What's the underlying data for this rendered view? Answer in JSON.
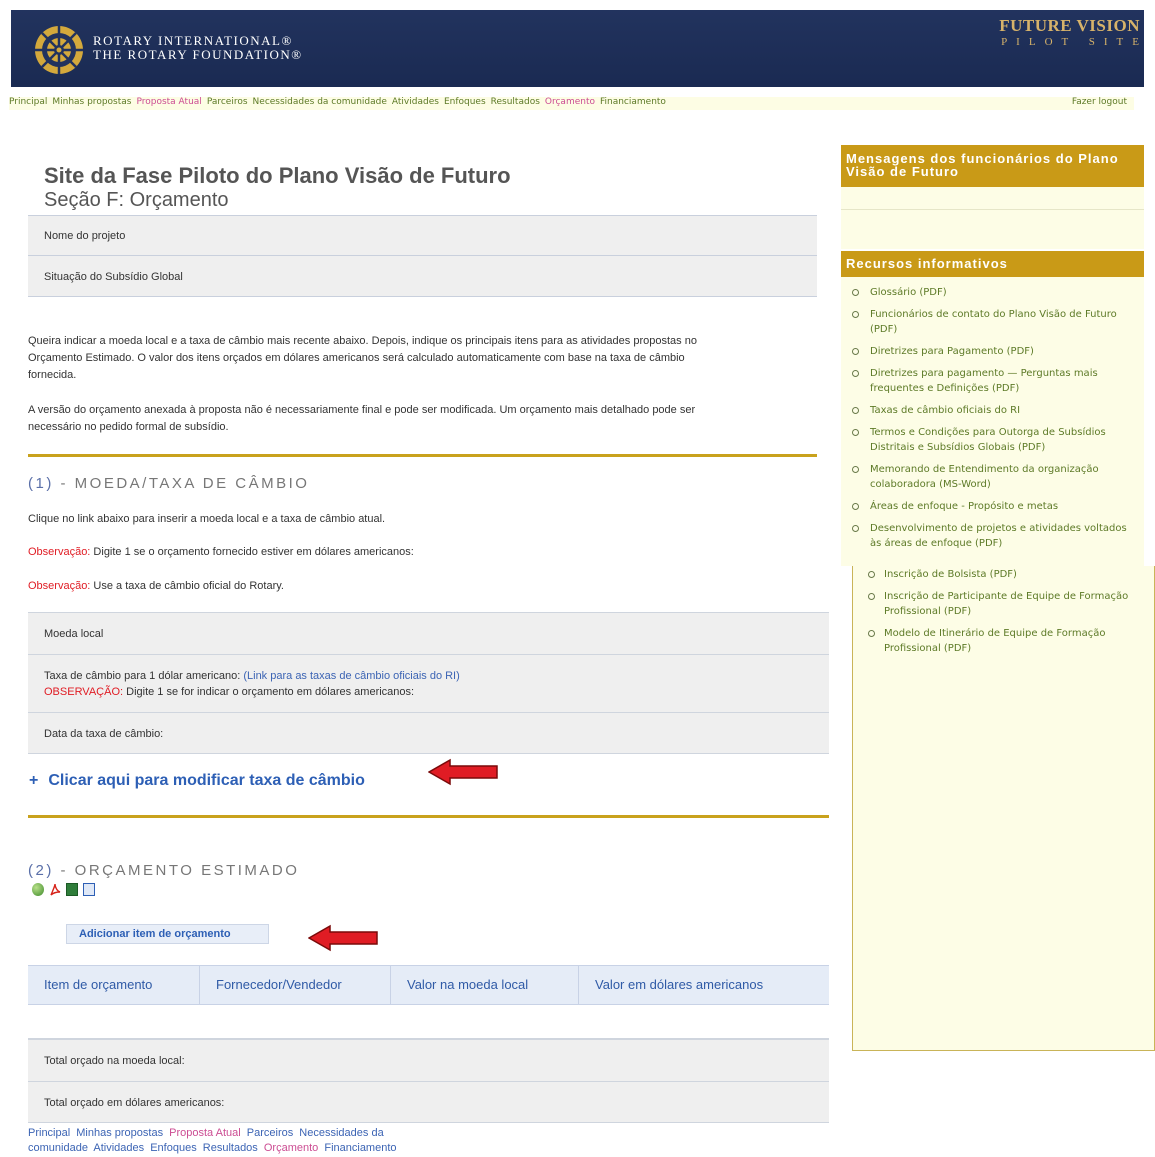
{
  "header": {
    "org_line1": "ROTARY INTERNATIONAL®",
    "org_line2": "THE ROTARY FOUNDATION®",
    "brand_line1": "FUTURE VISION",
    "brand_line2": "PILOT SITE"
  },
  "top_nav": {
    "items": [
      "Principal",
      "Minhas propostas",
      "Proposta Atual",
      "Parceiros",
      "Necessidades da comunidade",
      "Atividades",
      "Enfoques",
      "Resultados",
      "Orçamento",
      "Financiamento"
    ],
    "logout": "Fazer logout"
  },
  "page": {
    "title": "Site da Fase Piloto do Plano Visão de Futuro",
    "subtitle": "Seção F: Orçamento",
    "project_name_label": "Nome do projeto",
    "grant_status_label": "Situação do Subsídio Global",
    "intro_p1": "Queira indicar a moeda local e a taxa de câmbio mais recente abaixo. Depois, indique os principais itens para as atividades propostas no Orçamento Estimado. O valor dos itens orçados em dólares americanos será calculado automaticamente com base na taxa de câmbio fornecida.",
    "intro_p2": "A versão do orçamento anexada à proposta não é necessariamente final e pode ser modificada. Um orçamento mais detalhado pode ser necessário no pedido formal de subsídio."
  },
  "section1": {
    "num": "(1)",
    "title": "- MOEDA/TAXA DE CÂMBIO",
    "instruction": "Clique no link abaixo para inserir a moeda local e a taxa de câmbio atual.",
    "note_label": "Observação:",
    "note1": " Digite 1 se o orçamento fornecido estiver em dólares americanos:",
    "note2": " Use a taxa de câmbio oficial do Rotary.",
    "local_currency_label": "Moeda local",
    "rate_label": "Taxa de câmbio para 1 dólar americano: ",
    "rate_link": "(Link para as taxas de câmbio oficiais do RI)",
    "rate_note_label": "OBSERVAÇÃO:",
    "rate_note": " Digite 1 se for indicar o orçamento em dólares americanos:",
    "rate_date_label": "Data da taxa de câmbio:",
    "modify_plus": "+",
    "modify_link": "Clicar aqui para modificar taxa de câmbio"
  },
  "section2": {
    "num": "(2)",
    "title": "- ORÇAMENTO ESTIMADO",
    "export_icons": [
      "globe-icon",
      "pdf-icon",
      "excel-icon",
      "word-icon"
    ],
    "add_button": "Adicionar item de orçamento",
    "columns": [
      "Item de orçamento",
      "Fornecedor/Vendedor",
      "Valor na moeda local",
      "Valor em dólares americanos"
    ],
    "total_local_label": "Total orçado na moeda local:",
    "total_usd_label": "Total orçado em dólares americanos:"
  },
  "footer_nav": {
    "items": [
      "Principal",
      "Minhas propostas",
      "Proposta Atual",
      "Parceiros",
      "Necessidades da comunidade",
      "Atividades",
      "Enfoques",
      "Resultados",
      "Orçamento",
      "Financiamento"
    ]
  },
  "sidebar": {
    "messages_title": "Mensagens dos funcionários do Plano Visão de Futuro",
    "resources_title": "Recursos informativos",
    "resources": [
      "Glossário (PDF)",
      "Funcionários de contato do Plano Visão de Futuro (PDF)",
      "Diretrizes para Pagamento (PDF)",
      "Diretrizes para pagamento — Perguntas mais frequentes e Definições (PDF)",
      "Taxas de câmbio oficiais do RI",
      "Termos e Condições para Outorga de Subsídios Distritais e Subsídios Globais (PDF)",
      "Memorando de Entendimento da organização colaboradora (MS-Word)",
      "Áreas de enfoque - Propósito e metas",
      "Desenvolvimento de projetos e atividades voltados às áreas de enfoque (PDF)"
    ],
    "resources_extra": [
      "Inscrição de Bolsista (PDF)",
      "Inscrição de Participante de Equipe de Formação Profissional (PDF)",
      "Modelo de Itinerário de Equipe de Formação Profissional (PDF)"
    ]
  },
  "colors": {
    "header_navy": "#22335e",
    "gold": "#c9a21d",
    "link_blue": "#2d5fb5",
    "nav_green": "#5d7a27",
    "active_pink": "#cc4d93",
    "note_red": "#e01c24",
    "arrow_red": "#e01c24"
  }
}
